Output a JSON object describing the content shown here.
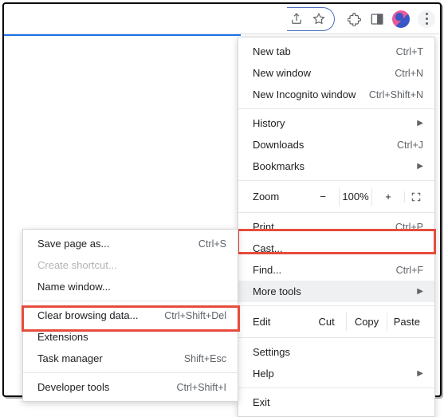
{
  "menu": {
    "new_tab": {
      "label": "New tab",
      "shortcut": "Ctrl+T"
    },
    "new_window": {
      "label": "New window",
      "shortcut": "Ctrl+N"
    },
    "new_incognito": {
      "label": "New Incognito window",
      "shortcut": "Ctrl+Shift+N"
    },
    "history": {
      "label": "History"
    },
    "downloads": {
      "label": "Downloads",
      "shortcut": "Ctrl+J"
    },
    "bookmarks": {
      "label": "Bookmarks"
    },
    "zoom": {
      "label": "Zoom",
      "minus": "−",
      "value": "100%",
      "plus": "+"
    },
    "print": {
      "label": "Print...",
      "shortcut": "Ctrl+P"
    },
    "cast": {
      "label": "Cast..."
    },
    "find": {
      "label": "Find...",
      "shortcut": "Ctrl+F"
    },
    "more_tools": {
      "label": "More tools"
    },
    "edit": {
      "label": "Edit",
      "cut": "Cut",
      "copy": "Copy",
      "paste": "Paste"
    },
    "settings": {
      "label": "Settings"
    },
    "help": {
      "label": "Help"
    },
    "exit": {
      "label": "Exit"
    }
  },
  "submenu": {
    "save_page": {
      "label": "Save page as...",
      "shortcut": "Ctrl+S"
    },
    "create_shortcut": {
      "label": "Create shortcut..."
    },
    "name_window": {
      "label": "Name window..."
    },
    "clear_data": {
      "label": "Clear browsing data...",
      "shortcut": "Ctrl+Shift+Del"
    },
    "extensions": {
      "label": "Extensions"
    },
    "task_manager": {
      "label": "Task manager",
      "shortcut": "Shift+Esc"
    },
    "dev_tools": {
      "label": "Developer tools",
      "shortcut": "Ctrl+Shift+I"
    }
  },
  "highlight_color": "#e74c3c"
}
